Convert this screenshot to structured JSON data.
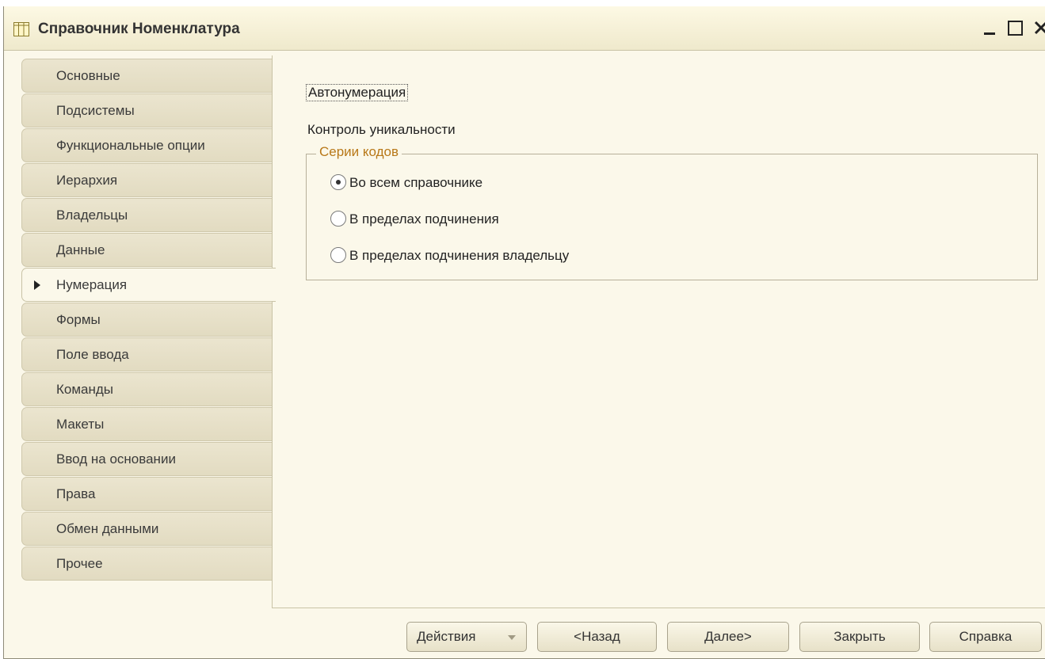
{
  "window": {
    "title": "Справочник Номенклатура",
    "icon": "table-icon"
  },
  "tabs": [
    {
      "label": "Основные",
      "active": false
    },
    {
      "label": "Подсистемы",
      "active": false
    },
    {
      "label": "Функциональные опции",
      "active": false
    },
    {
      "label": "Иерархия",
      "active": false
    },
    {
      "label": "Владельцы",
      "active": false
    },
    {
      "label": "Данные",
      "active": false
    },
    {
      "label": "Нумерация",
      "active": true
    },
    {
      "label": "Формы",
      "active": false
    },
    {
      "label": "Поле ввода",
      "active": false
    },
    {
      "label": "Команды",
      "active": false
    },
    {
      "label": "Макеты",
      "active": false
    },
    {
      "label": "Ввод на основании",
      "active": false
    },
    {
      "label": "Права",
      "active": false
    },
    {
      "label": "Обмен данными",
      "active": false
    },
    {
      "label": "Прочее",
      "active": false
    }
  ],
  "numbering": {
    "autonumbering": {
      "label": "Автонумерация",
      "checked": true
    },
    "uniqueness": {
      "label": "Контроль уникальности",
      "checked": true
    },
    "code_series": {
      "title": "Серии кодов",
      "options": [
        {
          "label": "Во всем справочнике",
          "selected": true
        },
        {
          "label": "В пределах подчинения",
          "selected": false
        },
        {
          "label": "В пределах подчинения владельцу",
          "selected": false
        }
      ]
    }
  },
  "footer": {
    "actions": "Действия",
    "back": "<Назад",
    "next": "Далее>",
    "close": "Закрыть",
    "help": "Справка"
  },
  "colors": {
    "background": "#fbf8ea",
    "tab": "#e6e0c7",
    "group_title": "#b87818"
  }
}
